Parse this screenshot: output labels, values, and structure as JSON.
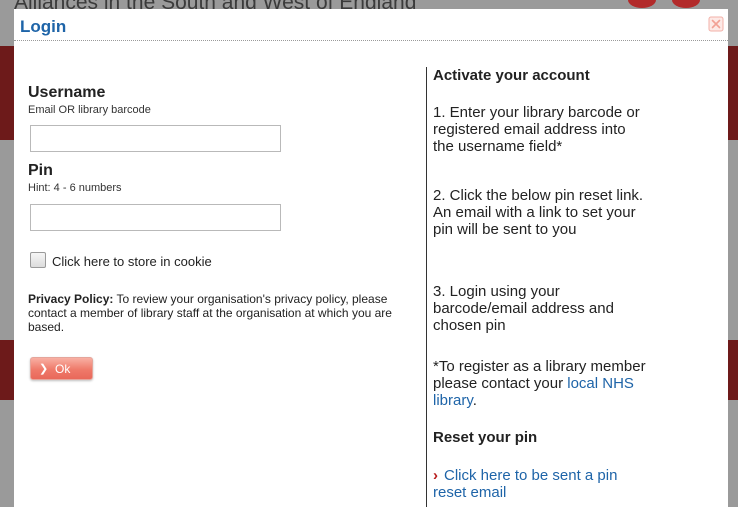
{
  "background": {
    "page_title": "Alliances in the South and West of England"
  },
  "dialog": {
    "title": "Login",
    "close_icon": "close-icon"
  },
  "form": {
    "username_label": "Username",
    "username_hint": "Email OR library barcode",
    "username_value": "",
    "pin_label": "Pin",
    "pin_hint": "Hint: 4 - 6 numbers",
    "pin_value": "",
    "cookie_label": "Click here to store in cookie",
    "cookie_checked": false,
    "privacy_title": "Privacy Policy:",
    "privacy_text": " To review your organisation's privacy policy, please contact a member of library staff at the organisation at which you are based.",
    "ok_label": "Ok"
  },
  "help": {
    "activate_heading": "Activate your account",
    "step1": "1. Enter your library barcode or registered email address into the username field*",
    "step2": "2. Click the below pin reset link. An email with a link to set your pin will be sent to you",
    "step3": "3. Login using your barcode/email address and chosen pin",
    "register_text": "*To register as a library member please contact your ",
    "register_link": "local NHS library",
    "register_end": ".",
    "reset_heading": "Reset your pin",
    "reset_link": "Click here to be sent a pin reset email"
  },
  "colors": {
    "accent": "#1e64a8",
    "ok_button": "#ef7a6a",
    "arrow": "#b81c1c"
  }
}
